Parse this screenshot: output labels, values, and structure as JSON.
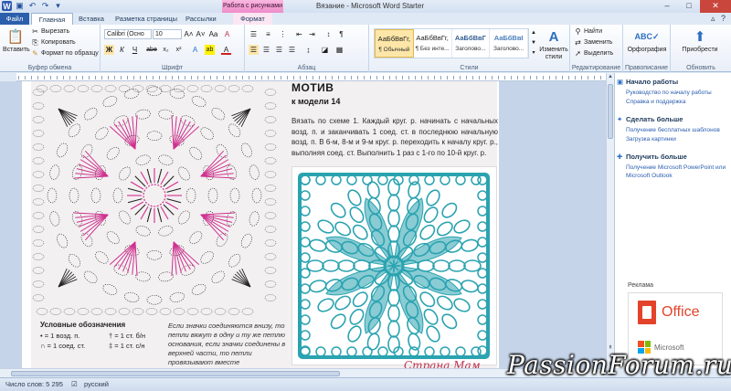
{
  "window": {
    "title": "Вязание  -  Microsoft Word Starter",
    "context_group": "Работа с рисунками",
    "controls": [
      "–",
      "□",
      "✕"
    ]
  },
  "tabs": [
    {
      "label": "Файл"
    },
    {
      "label": "Главная"
    },
    {
      "label": "Вставка"
    },
    {
      "label": "Разметка страницы"
    },
    {
      "label": "Рассылки"
    },
    {
      "label": "Формат"
    }
  ],
  "ribbon": {
    "clipboard": {
      "paste": "Вставить",
      "cut": "Вырезать",
      "copy": "Копировать",
      "format_painter": "Формат по образцу",
      "label": "Буфер обмена"
    },
    "font": {
      "family": "Calibri (Осно",
      "size": "10",
      "label": "Шрифт",
      "bold": "Ж",
      "italic": "К",
      "underline": "Ч",
      "strike": "abe",
      "sub": "x₂",
      "sup": "x²",
      "grow": "A˄",
      "shrink": "A˅",
      "case": "Aa",
      "clear": "A",
      "highlight": "ab",
      "color": "A"
    },
    "paragraph": {
      "label": "Абзац"
    },
    "styles": {
      "label": "Стили",
      "items": [
        {
          "sample": "АаБбВвГг,",
          "name": "¶ Обычный"
        },
        {
          "sample": "АаБбВвГг,",
          "name": "¶ Без инте..."
        },
        {
          "sample": "АаБбВвГ",
          "name": "Заголово..."
        },
        {
          "sample": "АаБбВвІ",
          "name": "Заголово..."
        }
      ],
      "change": "Изменить стили"
    },
    "editing": {
      "find": "Найти",
      "replace": "Заменить",
      "select": "Выделить",
      "label": "Редактирование"
    },
    "proofing": {
      "spelling": "Орфография",
      "label": "Правописание"
    },
    "update": {
      "apps": "Приобрести",
      "label": "Обновить"
    }
  },
  "document": {
    "motif_heading": "МОТИВ",
    "motif_sub": "к модели 14",
    "motif_text": "Вязать по схеме 1. Каждый круг. р. начинать с начальных возд. п. и заканчивать 1 соед. ст. в последнюю начальную возд. п. В 6-м, 8-м и 9-м круг. р. переходить к началу круг. р., выполняя соед. ст. Выполнить 1 раз с 1-го по 10-й круг. р.",
    "legend_title": "Условные обозначения",
    "legend": [
      "• = 1 возд. п.",
      "∩ = 1 соед. ст.",
      "† = 1 ст. б/н",
      "‡ = 1 ст. с/н"
    ],
    "note": "Если значки соединяются внизу, то петли вяжут в одну и ту же петлю основания, если значки соединены в верхней части, то петли провязывают вместе",
    "source_mark": "Страна Мам"
  },
  "pane": {
    "sections": [
      {
        "header": "Начало работы",
        "glyph": "▣",
        "links": [
          "Руководство по началу работы",
          "Справка и поддержка"
        ]
      },
      {
        "header": "Сделать больше",
        "glyph": "✦",
        "links": [
          "Получение бесплатных шаблонов",
          "Загрузка картинки"
        ]
      },
      {
        "header": "Получить больше",
        "glyph": "✚",
        "links": [
          "Получение Microsoft PowerPoint или Microsoft Outlook"
        ]
      }
    ],
    "ad_label": "Реклама",
    "ad_office": "Office",
    "ad_ms": "Microsoft"
  },
  "status": {
    "words": "Число слов: 5 295",
    "language": "русский"
  },
  "watermark": "PassionForum.ru",
  "colors": {
    "diagram_black": "#222222",
    "diagram_magenta": "#d0308f",
    "photo_thread": "#2aa3b0",
    "file_tab": "#2c5fab"
  }
}
